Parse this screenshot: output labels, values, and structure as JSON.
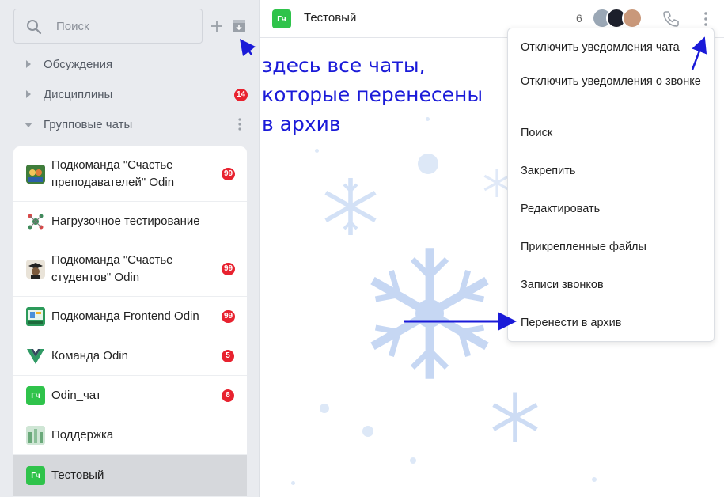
{
  "sidebar": {
    "search_placeholder": "Поиск",
    "sections": [
      {
        "label": "Обсуждения",
        "badge": null
      },
      {
        "label": "Дисциплины",
        "badge": "14"
      },
      {
        "label": "Групповые чаты",
        "badge": null
      }
    ],
    "chats": [
      {
        "name": "Подкоманда \"Счастье преподавателей\" Odin",
        "badge": "99"
      },
      {
        "name": "Нагрузочное тестирование",
        "badge": null
      },
      {
        "name": "Подкоманда \"Счастье студентов\" Odin",
        "badge": "99"
      },
      {
        "name": "Подкоманда Frontend Odin",
        "badge": "99"
      },
      {
        "name": "Команда Odin",
        "badge": "5"
      },
      {
        "name": "Odin_чат",
        "badge": "8",
        "avatar_text": "Гч"
      },
      {
        "name": "Поддержка",
        "badge": null
      },
      {
        "name": "Тестовый",
        "badge": null,
        "avatar_text": "Гч",
        "selected": true
      }
    ]
  },
  "header": {
    "avatar_text": "Гч",
    "title": "Тестовый",
    "member_count": "6"
  },
  "menu": {
    "items": [
      "Отключить уведомления чата",
      "Отключить уведомления о звонке",
      "Поиск",
      "Закрепить",
      "Редактировать",
      "Прикрепленные файлы",
      "Записи звонков",
      "Перенести в архив"
    ]
  },
  "annotation": {
    "lines": [
      "здесь все чаты,",
      "которые перенесены",
      "в архив"
    ]
  },
  "colors": {
    "accent_green": "#2fc34b",
    "badge_red": "#e8222f",
    "annotation_blue": "#1a1ad8",
    "snowflake": "#c6d7f3"
  },
  "icons": [
    "search-icon",
    "plus-icon",
    "archive-icon",
    "chevron-right-icon",
    "chevron-down-icon",
    "more-vertical-icon",
    "phone-icon",
    "snowflake-icon"
  ]
}
